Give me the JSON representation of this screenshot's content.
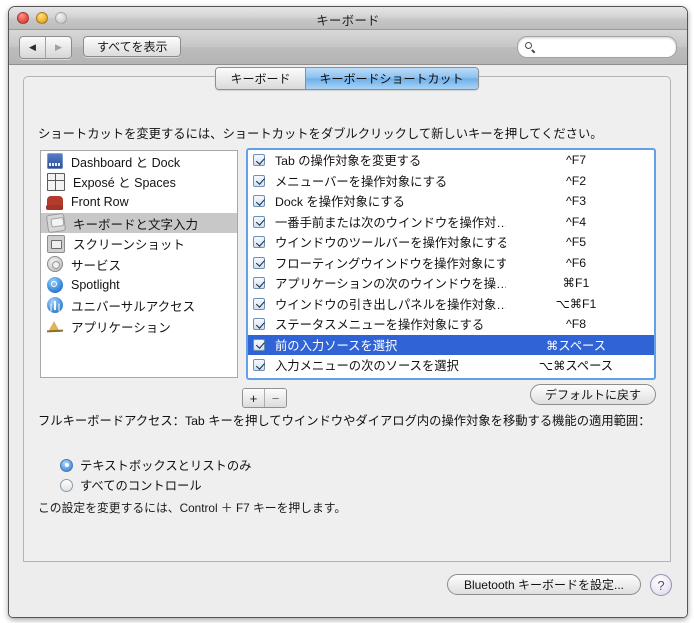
{
  "window": {
    "title": "キーボード",
    "traffic": {
      "close": "close-button",
      "minimize": "minimize-button",
      "zoom": "zoom-button"
    }
  },
  "toolbar": {
    "back_glyph": "◀",
    "forward_glyph": "▶",
    "show_all_label": "すべてを表示",
    "search_placeholder": "",
    "search_value": ""
  },
  "tabs": [
    {
      "label": "キーボード",
      "active": false
    },
    {
      "label": "キーボードショートカット",
      "active": true
    }
  ],
  "hint": "ショートカットを変更するには、ショートカットをダブルクリックして新しいキーを押してください。",
  "categories": [
    {
      "label": "Dashboard と Dock",
      "icon": "dashboard-icon",
      "selected": false
    },
    {
      "label": "Exposé と Spaces",
      "icon": "expose-icon",
      "selected": false
    },
    {
      "label": "Front Row",
      "icon": "front-row-icon",
      "selected": false
    },
    {
      "label": "キーボードと文字入力",
      "icon": "keyboard-icon",
      "selected": true
    },
    {
      "label": "スクリーンショット",
      "icon": "screenshot-icon",
      "selected": false
    },
    {
      "label": "サービス",
      "icon": "services-gear-icon",
      "selected": false
    },
    {
      "label": "Spotlight",
      "icon": "spotlight-icon",
      "selected": false
    },
    {
      "label": "ユニバーサルアクセス",
      "icon": "universal-access-icon",
      "selected": false
    },
    {
      "label": "アプリケーション",
      "icon": "applications-icon",
      "selected": false
    }
  ],
  "shortcuts": [
    {
      "checked": true,
      "name": "Tab の操作対象を変更する",
      "key": "^F7",
      "selected": false
    },
    {
      "checked": true,
      "name": "メニューバーを操作対象にする",
      "key": "^F2",
      "selected": false
    },
    {
      "checked": true,
      "name": "Dock を操作対象にする",
      "key": "^F3",
      "selected": false
    },
    {
      "checked": true,
      "name": "一番手前または次のウインドウを操作対…",
      "key": "^F4",
      "selected": false
    },
    {
      "checked": true,
      "name": "ウインドウのツールバーを操作対象にする",
      "key": "^F5",
      "selected": false
    },
    {
      "checked": true,
      "name": "フローティングウインドウを操作対象にする",
      "key": "^F6",
      "selected": false
    },
    {
      "checked": true,
      "name": "アプリケーションの次のウインドウを操…",
      "key": "⌘F1",
      "selected": false
    },
    {
      "checked": true,
      "name": "ウインドウの引き出しパネルを操作対象…",
      "key": "⌥⌘F1",
      "selected": false
    },
    {
      "checked": true,
      "name": "ステータスメニューを操作対象にする",
      "key": "^F8",
      "selected": false
    },
    {
      "checked": true,
      "name": "前の入力ソースを選択",
      "key": "⌘スペース",
      "selected": true
    },
    {
      "checked": true,
      "name": "入力メニューの次のソースを選択",
      "key": "⌥⌘スペース",
      "selected": false
    }
  ],
  "list_buttons": {
    "add": "+",
    "remove": "−"
  },
  "restore_label": "デフォルトに戻す",
  "full_keyboard_access_label": "フルキーボードアクセス：Tab キーを押してウインドウやダイアログ内の操作対象を移動する機能の適用範囲：",
  "radio_options": [
    {
      "label": "テキストボックスとリストのみ",
      "selected": true
    },
    {
      "label": "すべてのコントロール",
      "selected": false
    }
  ],
  "note": "この設定を変更するには、Control ＋ F7 キーを押します。",
  "bottom": {
    "bluetooth_label": "Bluetooth キーボードを設定...",
    "help_label": "?"
  },
  "colors": {
    "selection_blue": "#3063d6",
    "tab_active_blue": "#8ec2f0",
    "focus_ring": "#62a0e8",
    "sidebar_selection": "#c8c8c8",
    "window_bg": "#ededed"
  }
}
